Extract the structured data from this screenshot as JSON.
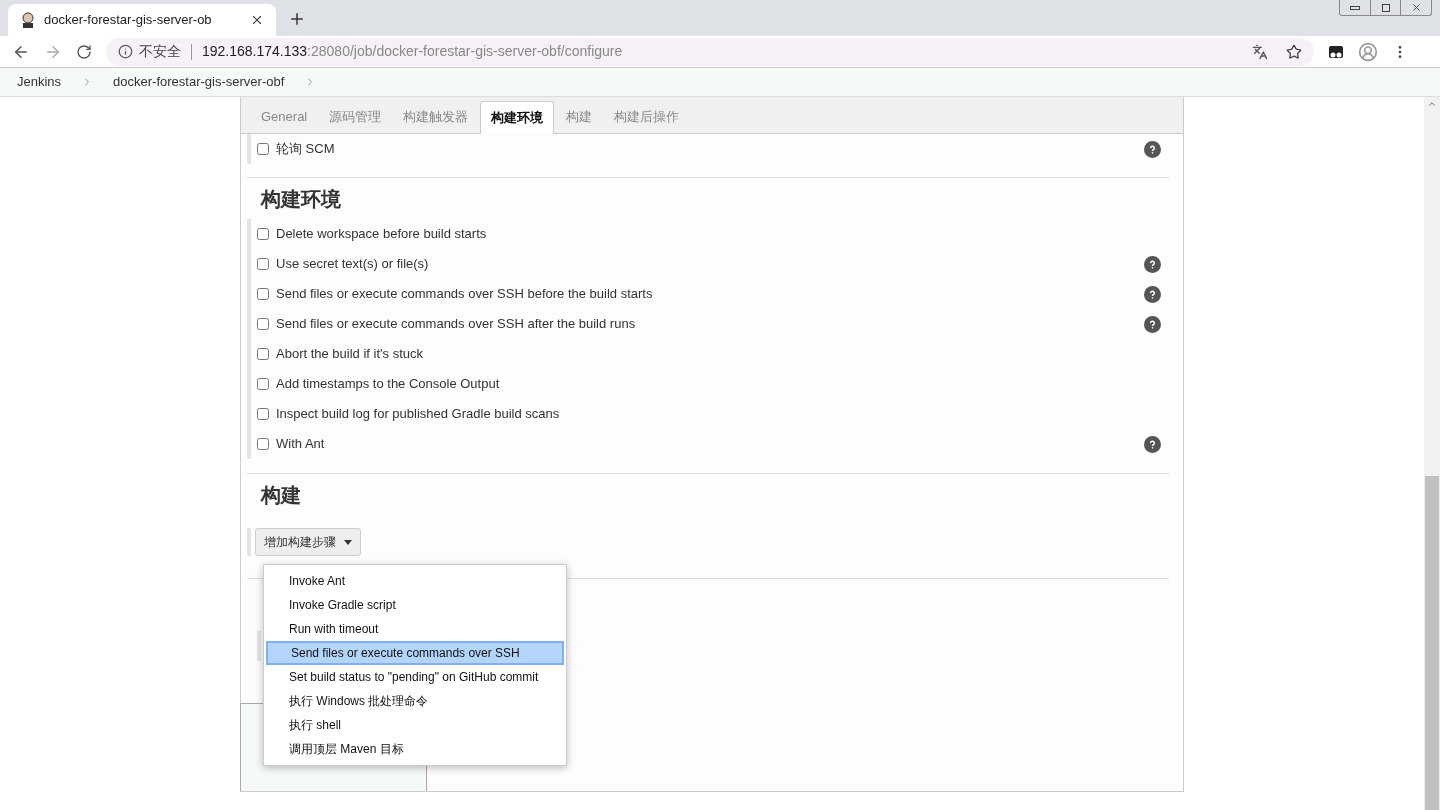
{
  "browser": {
    "tab_title": "docker-forestar-gis-server-ob",
    "security": "不安全",
    "url_host": "192.168.174.133",
    "url_path": ":28080/job/docker-forestar-gis-server-obf/configure"
  },
  "breadcrumbs": [
    "Jenkins",
    "docker-forestar-gis-server-obf"
  ],
  "tabs": [
    {
      "label": "General",
      "selected": false
    },
    {
      "label": "源码管理",
      "selected": false
    },
    {
      "label": "构建触发器",
      "selected": false
    },
    {
      "label": "构建环境",
      "selected": true
    },
    {
      "label": "构建",
      "selected": false
    },
    {
      "label": "构建后操作",
      "selected": false
    }
  ],
  "trigger_options": [
    {
      "label": "轮询 SCM",
      "checked": false,
      "help": true
    }
  ],
  "environment": {
    "title": "构建环境",
    "options": [
      {
        "label": "Delete workspace before build starts",
        "checked": false,
        "help": false
      },
      {
        "label": "Use secret text(s) or file(s)",
        "checked": false,
        "help": true
      },
      {
        "label": "Send files or execute commands over SSH before the build starts",
        "checked": false,
        "help": true
      },
      {
        "label": "Send files or execute commands over SSH after the build runs",
        "checked": false,
        "help": true
      },
      {
        "label": "Abort the build if it's stuck",
        "checked": false,
        "help": false
      },
      {
        "label": "Add timestamps to the Console Output",
        "checked": false,
        "help": false
      },
      {
        "label": "Inspect build log for published Gradle build scans",
        "checked": false,
        "help": false
      },
      {
        "label": "With Ant",
        "checked": false,
        "help": true
      }
    ]
  },
  "build": {
    "title": "构建",
    "add_step_button": "增加构建步骤",
    "menu": [
      {
        "label": "Invoke Ant",
        "selected": false
      },
      {
        "label": "Invoke Gradle script",
        "selected": false
      },
      {
        "label": "Run with timeout",
        "selected": false
      },
      {
        "label": "Send files or execute commands over SSH",
        "selected": true
      },
      {
        "label": "Set build status to \"pending\" on GitHub commit",
        "selected": false
      },
      {
        "label": "执行 Windows 批处理命令",
        "selected": false
      },
      {
        "label": "执行 shell",
        "selected": false
      },
      {
        "label": "调用顶层 Maven 目标",
        "selected": false
      }
    ]
  }
}
